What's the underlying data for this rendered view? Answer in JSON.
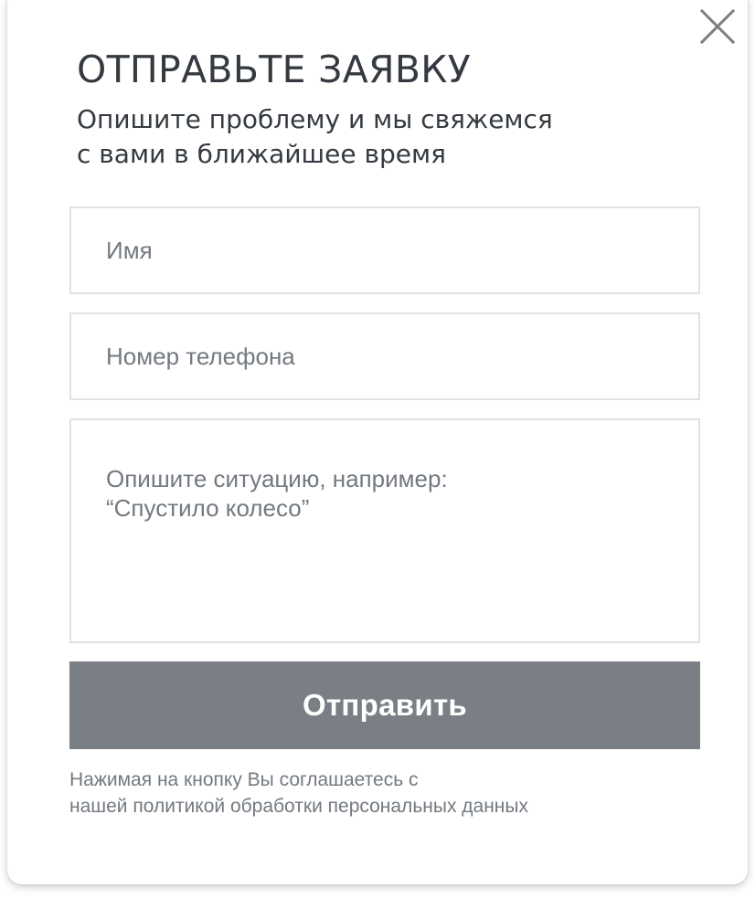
{
  "dialog": {
    "title": "ОТПРАВЬТЕ ЗАЯВКУ",
    "subtitle": {
      "line1": "Опишите проблему и мы свяжемся",
      "line2": "с вами в ближайшее время"
    },
    "close_icon": "close-icon"
  },
  "form": {
    "name_field": {
      "value": "",
      "placeholder": "Имя"
    },
    "phone_field": {
      "value": "",
      "placeholder": "Номер телефона"
    },
    "message_field": {
      "value": "",
      "placeholder": "Опишите ситуацию, например:\n“Спустило колесо”"
    },
    "submit_label": "Отправить"
  },
  "consent": {
    "line1": "Нажимая на кнопку Вы соглашаетесь с",
    "line2": "нашей политикой обработки персональных данных"
  },
  "colors": {
    "title_text": "#343a40",
    "placeholder_text": "#737980",
    "field_border": "#e2e2e2",
    "button_background": "#7a7f86",
    "button_text": "#ffffff",
    "close_icon": "#7b7f84"
  }
}
